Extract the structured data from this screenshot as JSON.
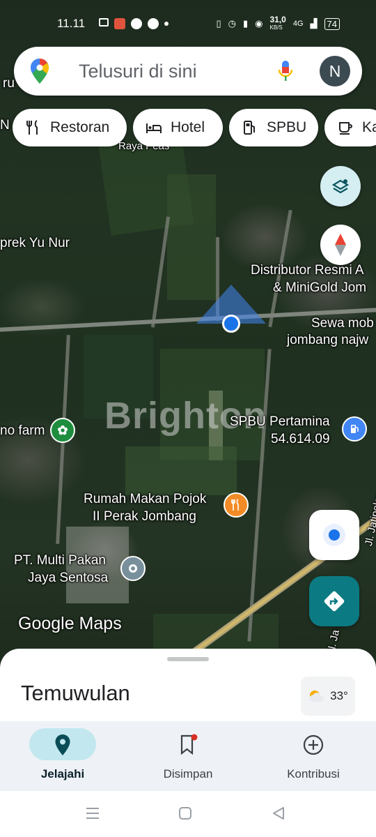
{
  "status_bar": {
    "time": "11.11",
    "speed": "31,0",
    "speed_unit": "KB/S",
    "network": "4G",
    "battery": "74"
  },
  "search": {
    "placeholder": "Telusuri di sini",
    "avatar_letter": "N"
  },
  "chips": [
    {
      "label": "Restoran",
      "icon": "restaurant-icon"
    },
    {
      "label": "Hotel",
      "icon": "hotel-icon"
    },
    {
      "label": "SPBU",
      "icon": "gas-station-icon"
    },
    {
      "label": "Ka",
      "icon": "coffee-icon"
    }
  ],
  "map": {
    "labels": {
      "top_left": "ru",
      "top_left_2": "N",
      "road_name": "Raya Peas",
      "place_1": "prek Yu Nur",
      "distributor_line1": "Distributor Resmi A",
      "distributor_line2": "& MiniGold Jom",
      "sewa_line1": "Sewa mob",
      "sewa_line2": "jombang najw",
      "farm": "no farm",
      "spbu_line1": "SPBU Pertamina",
      "spbu_line2": "54.614.09",
      "rumah_line1": "Rumah Makan Pojok",
      "rumah_line2": "II Perak Jombang",
      "pt_line1": "PT. Multi Pakan",
      "pt_line2": "Jaya Sentosa",
      "jl_jatipelem": "Jl. Jatipelem",
      "jl_ja": "Jl. Ja"
    },
    "watermark": "Brighton",
    "logo": "Google Maps"
  },
  "sheet": {
    "title": "Temuwulan",
    "weather": "33°"
  },
  "bottom_nav": [
    {
      "label": "Jelajahi",
      "icon": "explore-pin-icon",
      "active": true
    },
    {
      "label": "Disimpan",
      "icon": "bookmark-icon",
      "active": false
    },
    {
      "label": "Kontribusi",
      "icon": "add-circle-icon",
      "active": false
    }
  ],
  "colors": {
    "accent": "#0b7a82",
    "location_blue": "#1a73e8",
    "active_pill": "#c2e7ef"
  }
}
